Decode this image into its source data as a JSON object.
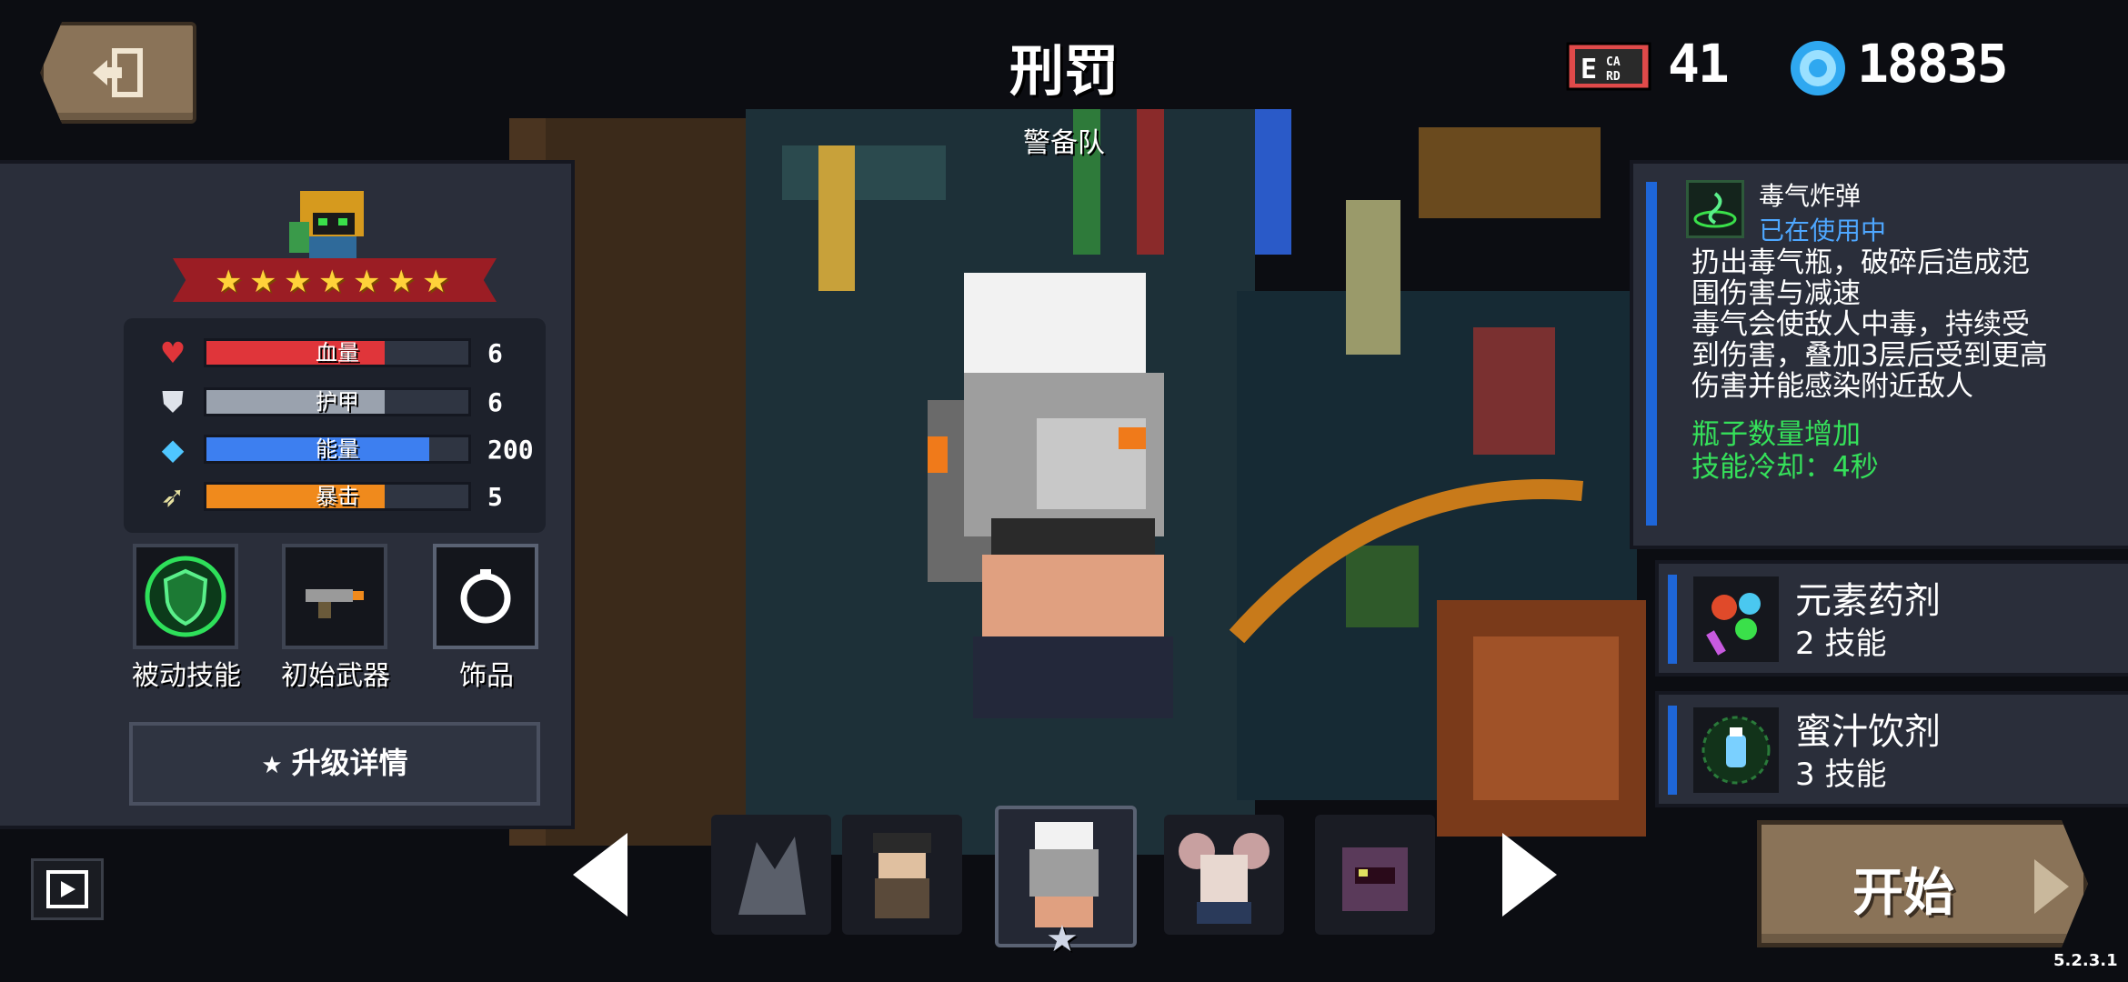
{
  "header": {
    "character_title": "刑罚",
    "character_subtitle": "警备队",
    "card_count": "41",
    "gem_count": "18835",
    "exit_icon": "exit-door-icon",
    "card_icon": "energy-card-icon",
    "gem_icon": "blue-gem-icon"
  },
  "character": {
    "star_count": 7,
    "stats": [
      {
        "icon": "heart-icon",
        "label": "血量",
        "value": "6",
        "fill": 0.68,
        "color": "#e0353a"
      },
      {
        "icon": "shield-icon",
        "label": "护甲",
        "value": "6",
        "fill": 0.68,
        "color": "#9aa2ae"
      },
      {
        "icon": "energy-crystal-icon",
        "label": "能量",
        "value": "200",
        "fill": 0.85,
        "color": "#3d7ff0"
      },
      {
        "icon": "crit-icon",
        "label": "暴击",
        "value": "5",
        "fill": 0.68,
        "color": "#f08a1c"
      }
    ],
    "slots": [
      {
        "label": "被动技能",
        "icon": "passive-shield-icon"
      },
      {
        "label": "初始武器",
        "icon": "starting-gun-icon"
      },
      {
        "label": "饰品",
        "icon": "accessory-ring-icon"
      }
    ],
    "upgrade_label": "升级详情"
  },
  "skill": {
    "name": "毒气炸弹",
    "status": "已在使用中",
    "description_lines": [
      "扔出毒气瓶，破碎后造成范",
      "围伤害与减速",
      "毒气会使敌人中毒，持续受",
      "到伤害，叠加3层后受到更高",
      "伤害并能感染附近敌人"
    ],
    "bonus": "瓶子数量增加",
    "cooldown": "技能冷却：4秒"
  },
  "alt_skills": [
    {
      "name": "元素药剂",
      "count": "2 技能",
      "icon": "elemental-potion-icon"
    },
    {
      "name": "蜜汁饮剂",
      "count": "3 技能",
      "icon": "honey-potion-icon"
    }
  ],
  "start_label": "开始",
  "version": "5.2.3.1",
  "colors": {
    "panel": "#2a2e3a",
    "button_brown": "#8a7358",
    "skill_blue": "#4ea7ff",
    "bonus_green": "#35e05a",
    "ribbon_red": "#9b1d24",
    "star_gold": "#ffd23a"
  }
}
